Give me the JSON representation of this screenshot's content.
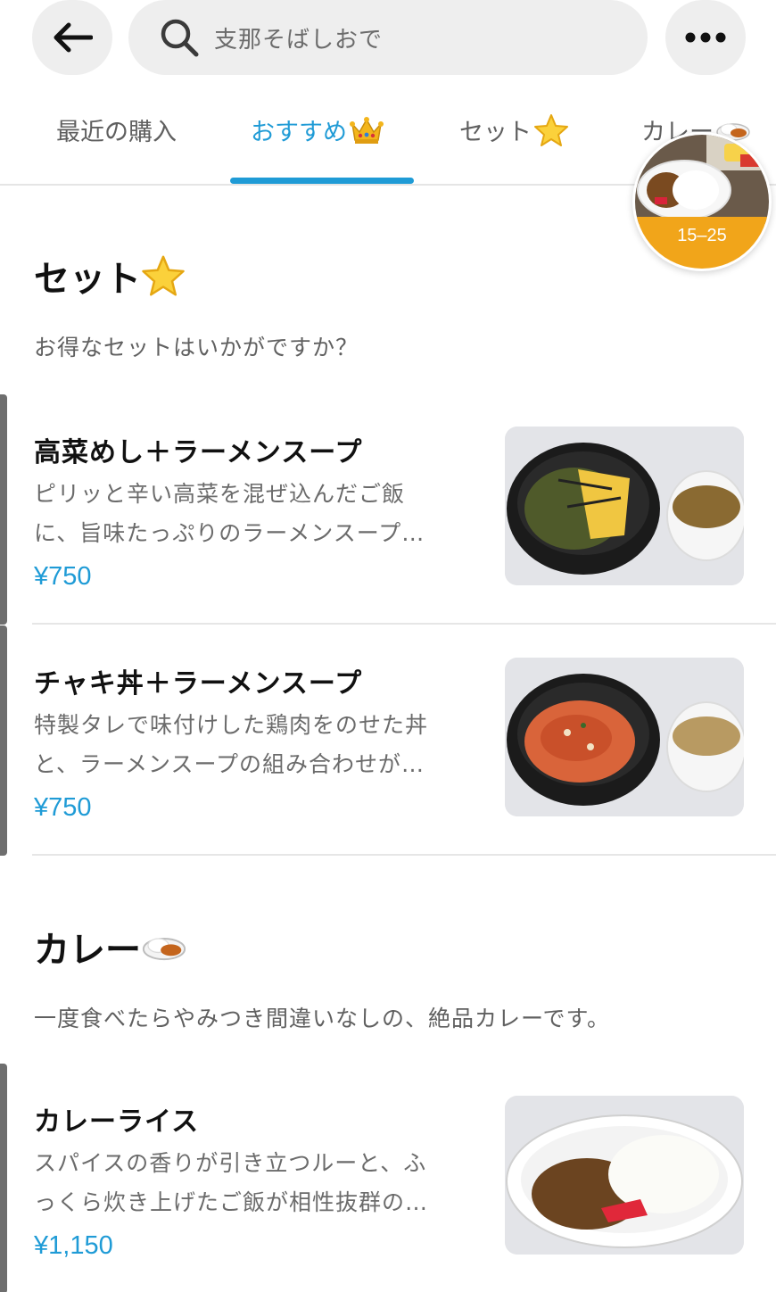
{
  "search": {
    "placeholder": "支那そばしおで"
  },
  "tabs": [
    {
      "label": "最近の購入",
      "emoji": ""
    },
    {
      "label": "おすすめ",
      "emoji": "crown-icon"
    },
    {
      "label": "セット",
      "emoji": "star-icon"
    },
    {
      "label": "カレー",
      "emoji": "curry-icon"
    }
  ],
  "floating": {
    "badge": "15–25"
  },
  "sections": [
    {
      "title": "セット",
      "emoji": "star-icon",
      "description": "お得なセットはいかがですか？",
      "items": [
        {
          "name": "高菜めし＋ラーメンスープ",
          "desc_line1": "ピリッと辛い高菜を混ぜ込んだご飯",
          "desc_line2": "に、旨味たっぷりのラーメンスープ…",
          "price": "¥750"
        },
        {
          "name": "チャキ丼＋ラーメンスープ",
          "desc_line1": "特製タレで味付けした鶏肉をのせた丼",
          "desc_line2": "と、ラーメンスープの組み合わせが…",
          "price": "¥750"
        }
      ]
    },
    {
      "title": "カレー",
      "emoji": "curry-icon",
      "description": "一度食べたらやみつき間違いなしの、絶品カレーです。",
      "items": [
        {
          "name": "カレーライス",
          "desc_line1": "スパイスの香りが引き立つルーと、ふ",
          "desc_line2": "っくら炊き上げたご飯が相性抜群の…",
          "price": "¥1,150"
        }
      ]
    }
  ],
  "colors": {
    "accent": "#1f9bd6",
    "badge": "#f1a51a",
    "pill": "#eeeeee"
  }
}
